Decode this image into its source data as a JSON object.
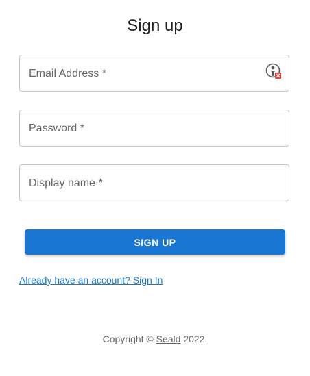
{
  "title": "Sign up",
  "fields": {
    "email": {
      "label": "Email Address *",
      "value": ""
    },
    "password": {
      "label": "Password *",
      "value": ""
    },
    "display_name": {
      "label": "Display name *",
      "value": ""
    }
  },
  "email_extension_icon": "password-manager-icon",
  "signup_button": {
    "label": "SIGN UP"
  },
  "signin_link": {
    "label": "Already have an account? Sign In"
  },
  "copyright": {
    "prefix": "Copyright © ",
    "brand": "Seald",
    "suffix": " 2022."
  },
  "colors": {
    "primary": "#1976d2",
    "text": "#212121",
    "muted": "#666666",
    "border": "#c4c4c4"
  }
}
